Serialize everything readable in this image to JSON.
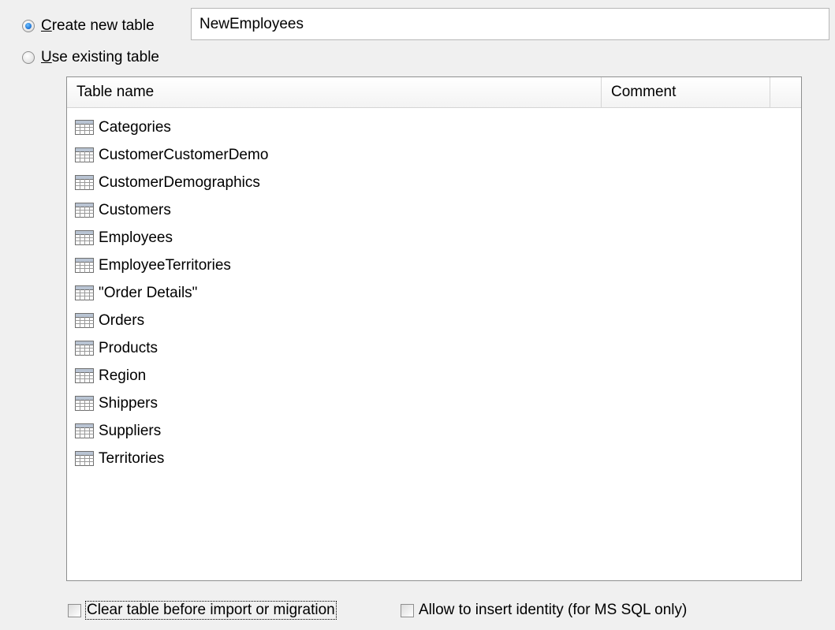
{
  "options": {
    "create_new": {
      "label_key": "C",
      "label_rest": "reate new table",
      "checked": true
    },
    "use_existing": {
      "label_key": "U",
      "label_rest": "se existing table",
      "checked": false
    },
    "new_table_name": "NewEmployees"
  },
  "table": {
    "columns": [
      "Table name",
      "Comment"
    ],
    "rows": [
      {
        "name": "Categories"
      },
      {
        "name": "CustomerCustomerDemo"
      },
      {
        "name": "CustomerDemographics"
      },
      {
        "name": "Customers"
      },
      {
        "name": "Employees"
      },
      {
        "name": "EmployeeTerritories"
      },
      {
        "name": "\"Order Details\""
      },
      {
        "name": "Orders"
      },
      {
        "name": "Products"
      },
      {
        "name": "Region"
      },
      {
        "name": "Shippers"
      },
      {
        "name": "Suppliers"
      },
      {
        "name": "Territories"
      }
    ],
    "row_icon": "table-icon"
  },
  "checkboxes": {
    "clear_table": {
      "label": "Clear table before import or migration",
      "checked": false
    },
    "allow_identity": {
      "label": "Allow to insert identity (for MS SQL only)",
      "checked": false
    }
  }
}
